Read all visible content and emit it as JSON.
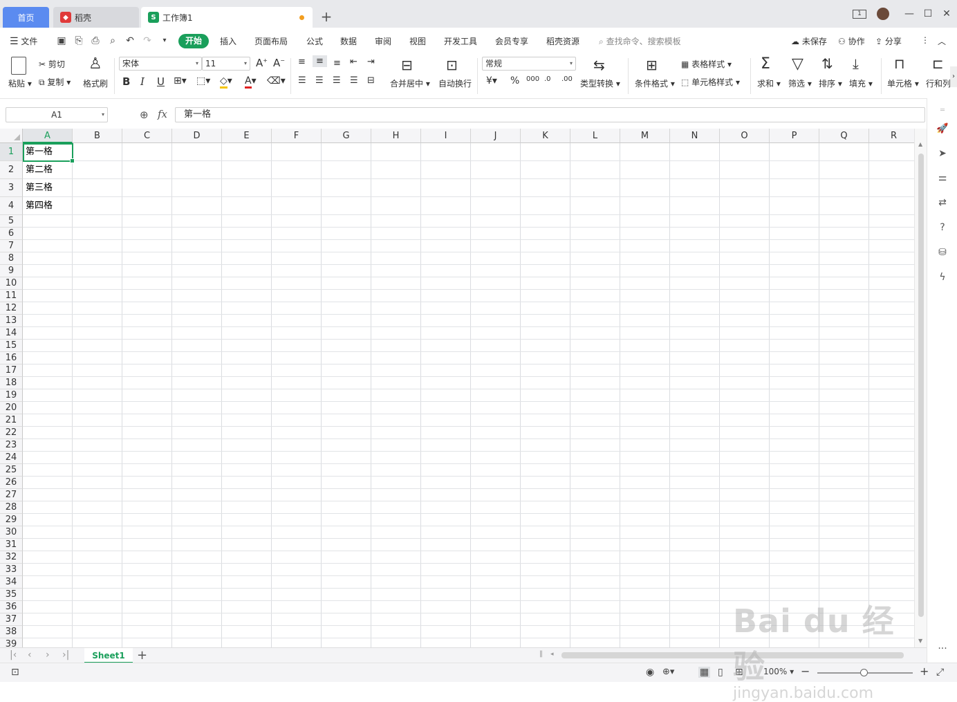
{
  "tabs": {
    "home": "首页",
    "daoke": "稻壳",
    "workbook": "工作簿1",
    "workbook_icon": "S",
    "add": "+"
  },
  "window": {
    "badge": "1",
    "minimize": "—",
    "maximize": "☐",
    "close": "✕"
  },
  "menu": {
    "file": "文件",
    "items": [
      "开始",
      "插入",
      "页面布局",
      "公式",
      "数据",
      "审阅",
      "视图",
      "开发工具",
      "会员专享",
      "稻壳资源"
    ],
    "search": "查找命令、搜索模板",
    "unsaved": "未保存",
    "collab": "协作",
    "share": "分享"
  },
  "ribbon": {
    "paste": "粘贴",
    "cut": "剪切",
    "copy": "复制",
    "format_painter": "格式刷",
    "font_name": "宋体",
    "font_size": "11",
    "merge_center": "合并居中",
    "wrap_text": "自动换行",
    "number_format": "常规",
    "type_convert": "类型转换",
    "cond_format": "条件格式",
    "table_style": "表格样式",
    "cell_style": "单元格样式",
    "sum": "求和",
    "filter": "筛选",
    "sort": "排序",
    "fill": "填充",
    "cell": "单元格",
    "row_col": "行和列"
  },
  "formula": {
    "name_box": "A1",
    "fx": "fx",
    "value": "第一格"
  },
  "grid": {
    "columns": [
      "A",
      "B",
      "C",
      "D",
      "E",
      "F",
      "G",
      "H",
      "I",
      "J",
      "K",
      "L",
      "M",
      "N",
      "O",
      "P",
      "Q",
      "R"
    ],
    "active_column": "A",
    "active_row": 1,
    "cells": [
      {
        "ref": "A1",
        "value": "第一格"
      },
      {
        "ref": "A2",
        "value": "第二格"
      },
      {
        "ref": "A3",
        "value": "第三格"
      },
      {
        "ref": "A4",
        "value": "第四格"
      }
    ]
  },
  "sheets": {
    "active": "Sheet1",
    "add": "+"
  },
  "status": {
    "zoom": "100%"
  },
  "watermark": {
    "line1": "Bai du 经验",
    "line2": "jingyan.baidu.com"
  },
  "colors": {
    "accent": "#1a9f5b",
    "home_tab": "#5b8bf0",
    "daoke_icon": "#e03a3a",
    "unsaved_dot": "#f29d1f"
  }
}
